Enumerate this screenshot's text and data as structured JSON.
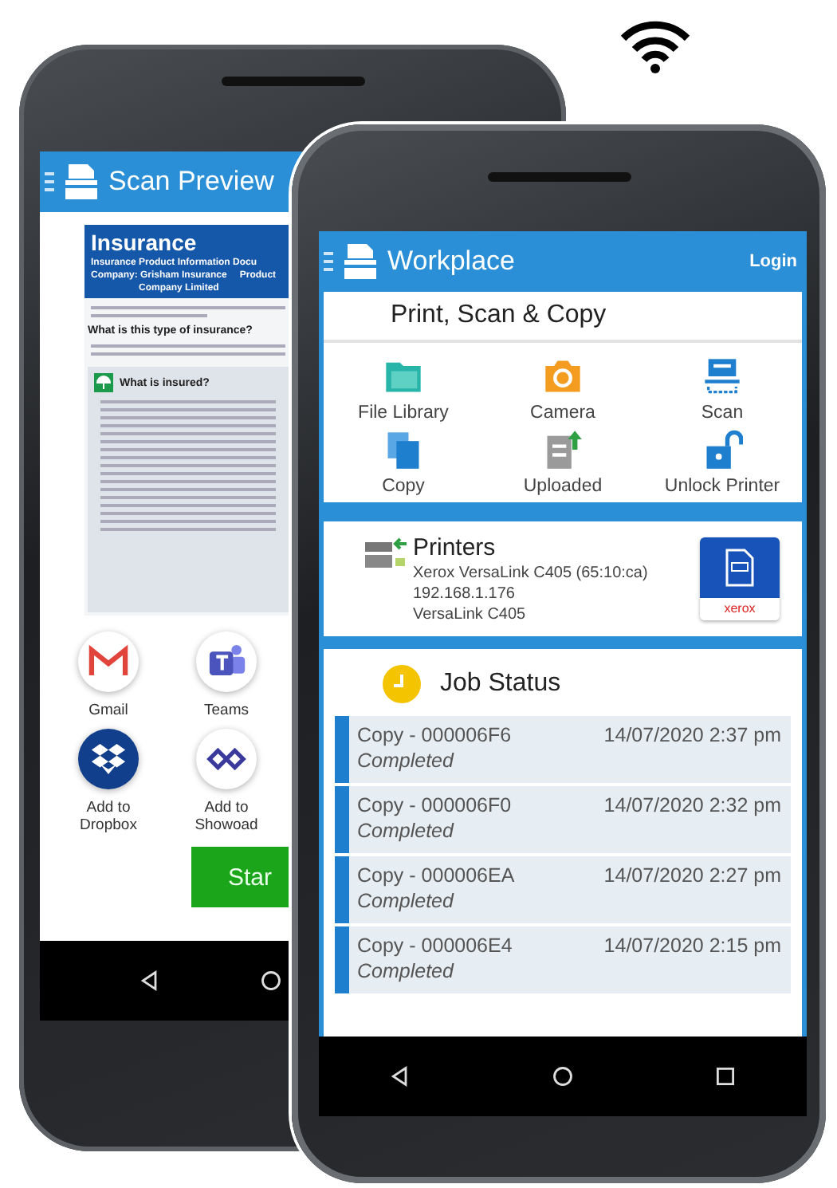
{
  "back_phone": {
    "title": "Scan Preview",
    "document": {
      "heading": "Insurance",
      "subheading": "Insurance Product Information Docu",
      "company": "Company: Grisham Insurance",
      "company_2": "Company Limited",
      "product": "Product",
      "question": "What is this type of insurance?",
      "box_title": "What is insured?"
    },
    "share_targets": [
      {
        "label": "Gmail",
        "kind": "gmail"
      },
      {
        "label": "Teams",
        "kind": "teams"
      },
      {
        "label": "Add to Dropbox",
        "kind": "dropbox"
      },
      {
        "label": "Add to Showoad",
        "kind": "showpad"
      }
    ],
    "start_button": "Star"
  },
  "front_phone": {
    "title": "Workplace",
    "login": "Login",
    "apps_card": {
      "title": "Print, Scan & Copy",
      "apps": [
        {
          "label": "File Library",
          "kind": "folder"
        },
        {
          "label": "Camera",
          "kind": "camera"
        },
        {
          "label": "Scan",
          "kind": "scan"
        },
        {
          "label": "Copy",
          "kind": "copy"
        },
        {
          "label": "Uploaded",
          "kind": "upload"
        },
        {
          "label": "Unlock Printer",
          "kind": "unlock"
        }
      ]
    },
    "printers": {
      "title": "Printers",
      "lines": [
        "Xerox VersaLink C405 (65:10:ca)",
        "192.168.1.176",
        "VersaLink C405"
      ],
      "brand": "xerox"
    },
    "job_status": {
      "title": "Job Status",
      "jobs": [
        {
          "name": "Copy - 000006F6",
          "time": "14/07/2020 2:37 pm",
          "status": "Completed"
        },
        {
          "name": "Copy - 000006F0",
          "time": "14/07/2020 2:32 pm",
          "status": "Completed"
        },
        {
          "name": "Copy - 000006EA",
          "time": "14/07/2020 2:27 pm",
          "status": "Completed"
        },
        {
          "name": "Copy - 000006E4",
          "time": "14/07/2020 2:15 pm",
          "status": "Completed"
        }
      ]
    }
  }
}
